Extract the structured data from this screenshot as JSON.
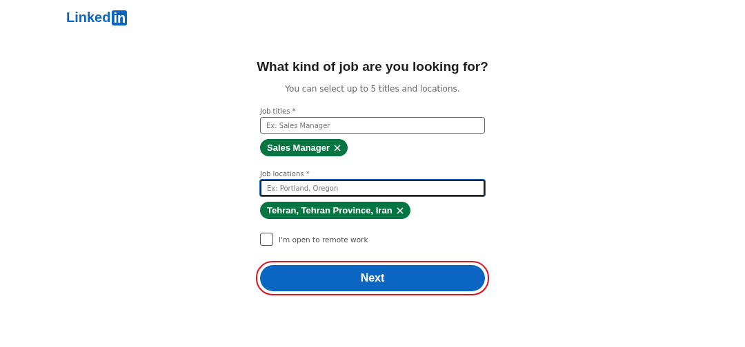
{
  "logo": {
    "word": "Linked",
    "badge": "in"
  },
  "heading": "What kind of job are you looking for?",
  "subtitle": "You can select up to 5 titles and locations.",
  "fields": [
    {
      "label": "Job titles *",
      "placeholder": "Ex: Sales Manager",
      "focused": false,
      "chips": [
        "Sales Manager"
      ]
    },
    {
      "label": "Job locations *",
      "placeholder": "Ex: Portland, Oregon",
      "focused": true,
      "chips": [
        "Tehran, Tehran Province, Iran"
      ]
    }
  ],
  "remote": {
    "label": "I'm open to remote work",
    "checked": false
  },
  "next_button": {
    "label": "Next",
    "highlighted": true
  }
}
